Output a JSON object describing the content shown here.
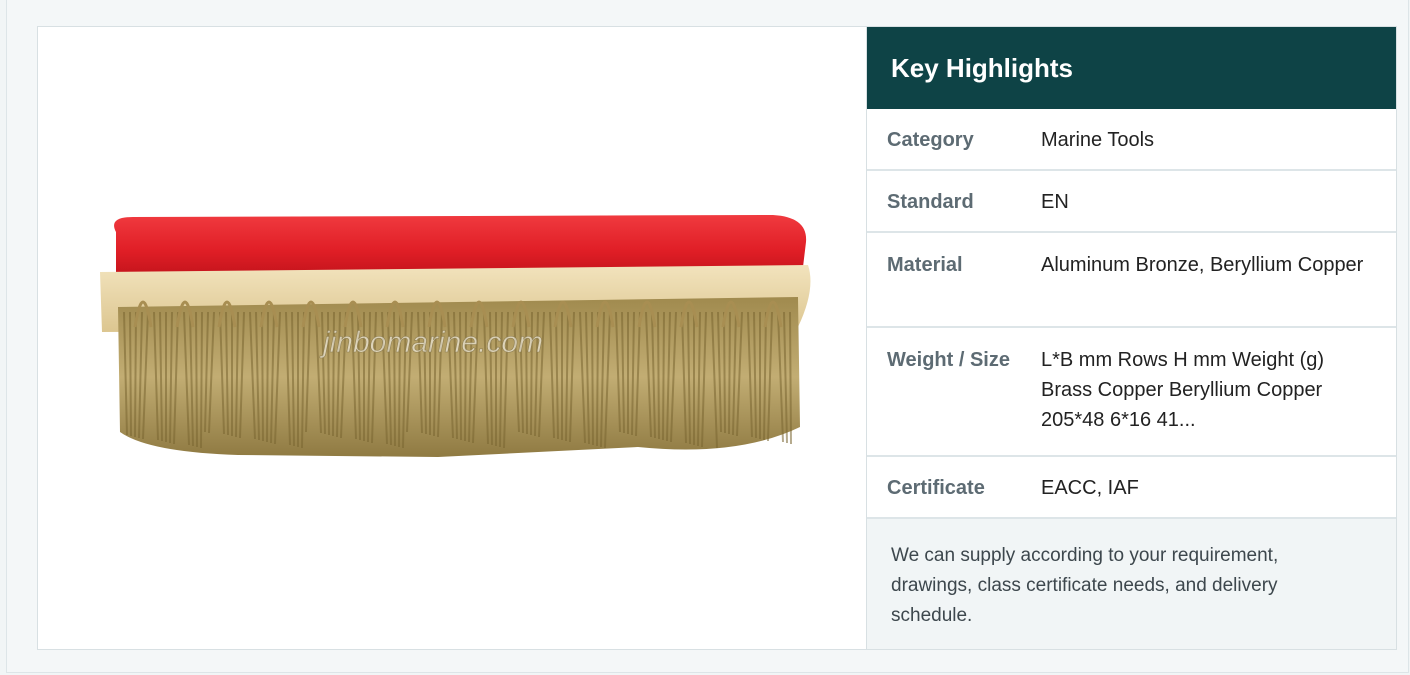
{
  "product_image": {
    "watermark": "jinbomarine.com",
    "colors": {
      "handle": "#e4202a",
      "wood": "#e9d6a8",
      "bristle": "#b7a266"
    }
  },
  "key_highlights": {
    "title": "Key Highlights",
    "rows": [
      {
        "label": "Category",
        "value": "Marine Tools"
      },
      {
        "label": "Standard",
        "value": "EN"
      },
      {
        "label": "Material",
        "value": "Aluminum Bronze, Beryllium Copper"
      },
      {
        "label": "Weight / Size",
        "value": "L*B mm Rows H mm Weight (g) Brass Copper Beryllium Copper 205*48 6*16 41..."
      },
      {
        "label": "Certificate",
        "value": "EACC, IAF"
      }
    ],
    "note": "We can supply according to your requirement, drawings, class certificate needs, and delivery schedule."
  },
  "colors": {
    "header_bg": "#0e4346",
    "label_text": "#5d6b73",
    "border": "#d8e0e3"
  }
}
